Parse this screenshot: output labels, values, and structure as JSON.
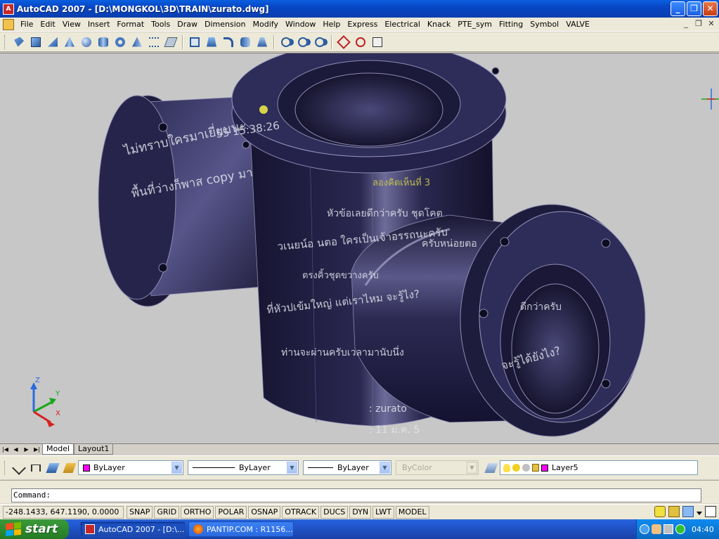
{
  "window": {
    "title": "AutoCAD 2007 - [D:\\MONGKOL\\3D\\TRAIN\\zurato.dwg]",
    "app_icon": "A"
  },
  "menu": {
    "items": [
      "File",
      "Edit",
      "View",
      "Insert",
      "Format",
      "Tools",
      "Draw",
      "Dimension",
      "Modify",
      "Window",
      "Help",
      "Express",
      "Electrical",
      "Knack",
      "PTE_sym",
      "Fitting",
      "Symbol",
      "VALVE"
    ]
  },
  "viewport": {
    "engraved_text": [
      "ไม่ทราบใครมาเยี่ยมนะ",
      "พื้นที่ว่างก็พาส copy มา",
      "55 15:38:26",
      "ลองคิดเห็นที่ 3",
      "หัวข้อเลยดีกว่าครับ ชุดโคต",
      "วเนยน์อ นตอ ใครเป็นเจ้าอรรถนะครับ",
      "ครับหน่อยตอ",
      "ตรงคิ้วชุดขวางครับ",
      "ที่หัวปเข้มใหญ่ แต่เราไหม จะรู้ไง?",
      "ดีกว่าครับ",
      "จะรู้ได้ยังไง?",
      "ท่านจะผ่านครับเวลามานับนึ่ง",
      ": zurato",
      ": 11 ม.ค. 5"
    ],
    "ucs": {
      "x": "X",
      "y": "Y",
      "z": "Z"
    }
  },
  "tabs": {
    "items": [
      "Model",
      "Layout1"
    ],
    "active": "Model"
  },
  "properties": {
    "color": "ByLayer",
    "linetype": "ByLayer",
    "lineweight": "ByLayer",
    "plotstyle": "ByColor",
    "layer": "Layer5"
  },
  "command": {
    "prompt": "Command:"
  },
  "status": {
    "coords": "-248.1433, 647.1190, 0.0000",
    "toggles": [
      "SNAP",
      "GRID",
      "ORTHO",
      "POLAR",
      "OSNAP",
      "OTRACK",
      "DUCS",
      "DYN",
      "LWT",
      "MODEL"
    ]
  },
  "taskbar": {
    "start_label": "start",
    "tasks": [
      "AutoCAD 2007 - [D:\\...",
      "PANTIP.COM : R1156..."
    ],
    "clock": "04:40"
  },
  "colors": {
    "model_body": "#24223f",
    "model_highlight": "#8f8db8",
    "viewport_bg": "#c7c7c7",
    "engrave_text": "#e6e6ee",
    "engrave_yellow": "#d6d24a"
  }
}
